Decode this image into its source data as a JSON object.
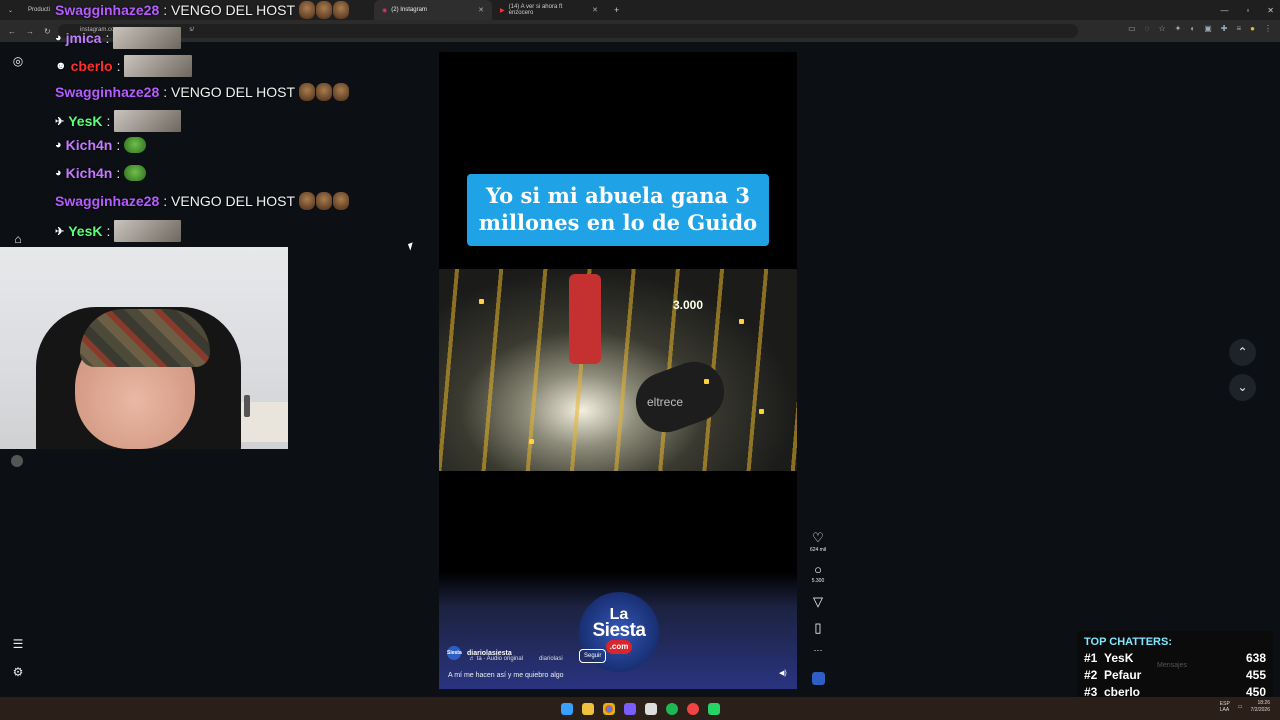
{
  "browser": {
    "tabs": [
      {
        "label": "Producti"
      },
      {
        "label": "(2) Instagram",
        "active": true
      },
      {
        "label": "(14) A ver si ahora ft enzocero"
      }
    ],
    "url": "instagram.com",
    "url_suffix": "s/"
  },
  "chat": [
    {
      "user": "Swagginhaze28",
      "text": ": VENGO DEL HOST",
      "color": "#b65cff",
      "attachment": "emotes"
    },
    {
      "user": "jmica",
      "text": ":",
      "color": "#c17dff",
      "attachment": "thumb"
    },
    {
      "user": "cberlo",
      "text": ":",
      "color": "#ff2e2e",
      "attachment": "thumb"
    },
    {
      "user": "Swagginhaze28",
      "text": ": VENGO DEL HOST",
      "color": "#b65cff",
      "attachment": "emotes"
    },
    {
      "user": "YesK",
      "text": ":",
      "color": "#5cff7a",
      "attachment": "thumb"
    },
    {
      "user": "Kich4n",
      "text": ":",
      "color": "#c678ff",
      "attachment": "frog"
    },
    {
      "user": "Kich4n",
      "text": ":",
      "color": "#c678ff",
      "attachment": "frog"
    },
    {
      "user": "Swagginhaze28",
      "text": ": VENGO DEL HOST",
      "color": "#b65cff",
      "attachment": "emotes"
    },
    {
      "user": "YesK",
      "text": ":",
      "color": "#5cff7a",
      "attachment": "thumb"
    }
  ],
  "reel": {
    "caption": "Yo si mi abuela gana 3 millones en lo de Guido",
    "video_watermark": "eltrece",
    "video_score": "3.000",
    "logo": {
      "la": "La",
      "siesta": "Siesta",
      "com": ".com"
    },
    "account": "diariolasiesta",
    "avatar_text": "Siesta",
    "audio": "♬ ta · Audio original",
    "audio2": "diariolasi",
    "follow_label": "Seguir",
    "description": "A mí me hacen así y me quiebro algo",
    "likes": "624 mil",
    "comments": "5.300",
    "more": "···"
  },
  "top_chatters": {
    "title": "TOP CHATTERS:",
    "rows": [
      {
        "rank": "#1",
        "name": "YesK",
        "count": "638"
      },
      {
        "rank": "#2",
        "name": "Pefaur",
        "count": "455"
      },
      {
        "rank": "#3",
        "name": "cberlo",
        "count": "450"
      }
    ],
    "mensajes": "Mensajes"
  },
  "tray": {
    "lang": "ESP",
    "lang2": "LAA",
    "time": "18:26",
    "date": "7/2/2026"
  }
}
